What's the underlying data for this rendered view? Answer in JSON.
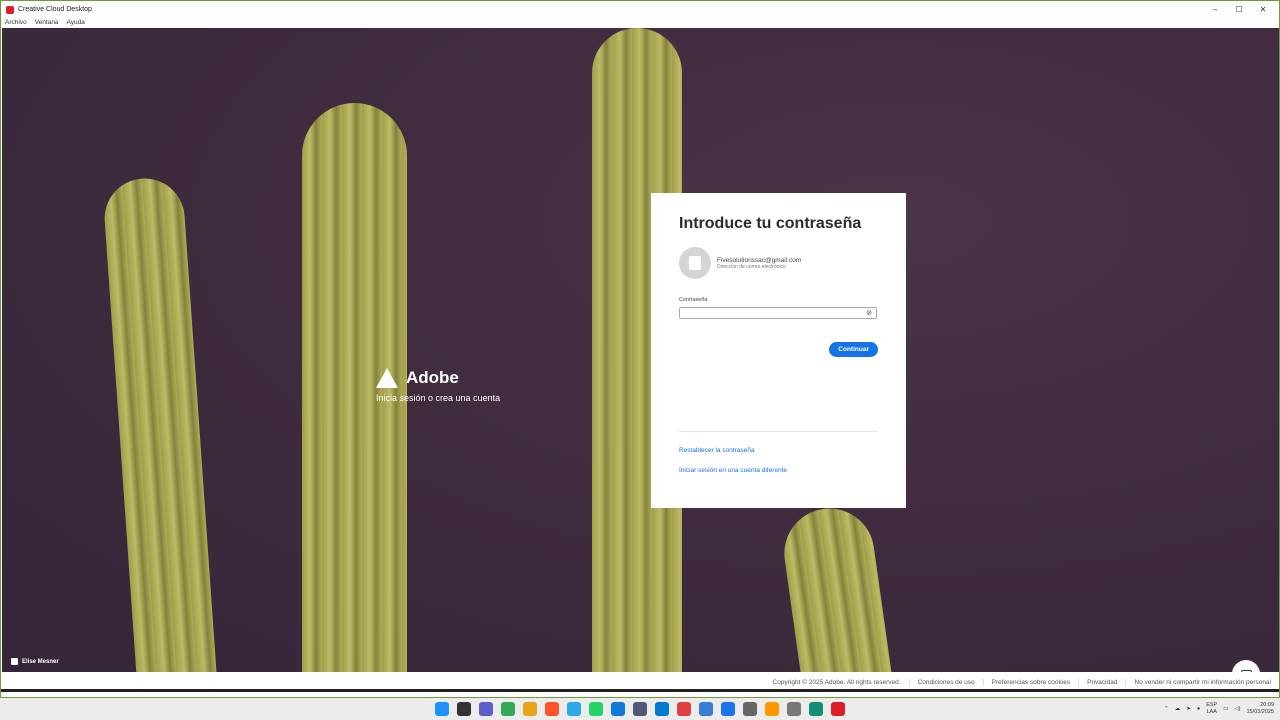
{
  "window": {
    "title": "Creative Cloud Desktop",
    "controls": [
      "–",
      "☐",
      "✕"
    ]
  },
  "menu": [
    "Archivo",
    "Ventana",
    "Ayuda"
  ],
  "brand": {
    "name": "Adobe",
    "tagline": "Inicia sesión o crea una cuenta"
  },
  "dialog": {
    "title": "Introduce tu contraseña",
    "email": "Fivesolutionssac@gmail.com",
    "email_caption": "Dirección de correo electrónico",
    "password_label": "Contraseña",
    "password_value": "",
    "continue_label": "Continuar",
    "reset_link": "Restablecer la contraseña",
    "other_account_link": "Iniciar sesión en una cuenta diferente"
  },
  "user_badge": "Elise Mesner",
  "footer": [
    "Copyright © 2025 Adobe. All rights reserved.",
    "Condiciones de uso",
    "Preferencias sobre cookies",
    "Privacidad",
    "No vender ni compartir mi información personal"
  ],
  "taskbar": {
    "icons": [
      "windows-start",
      "search",
      "teams",
      "chrome",
      "chrome-canary",
      "brave",
      "telegram",
      "whatsapp",
      "edge",
      "app-1",
      "vscode",
      "app-red",
      "app-mail",
      "app-blue",
      "settings",
      "sublime",
      "app-circle",
      "edge-beta",
      "creative-cloud"
    ],
    "icon_colors": [
      "#1e90ff",
      "#333333",
      "#5b5fc7",
      "#34a853",
      "#e8a317",
      "#fb542b",
      "#2aabee",
      "#25d366",
      "#0f7bd6",
      "#555577",
      "#007acc",
      "#e04040",
      "#3a7bd5",
      "#1a73e8",
      "#666666",
      "#ff9800",
      "#777777",
      "#138d75",
      "#da1f26"
    ],
    "language": "ESP",
    "language_sub": "LAA",
    "time": "20:09",
    "date": "15/03/2025"
  }
}
